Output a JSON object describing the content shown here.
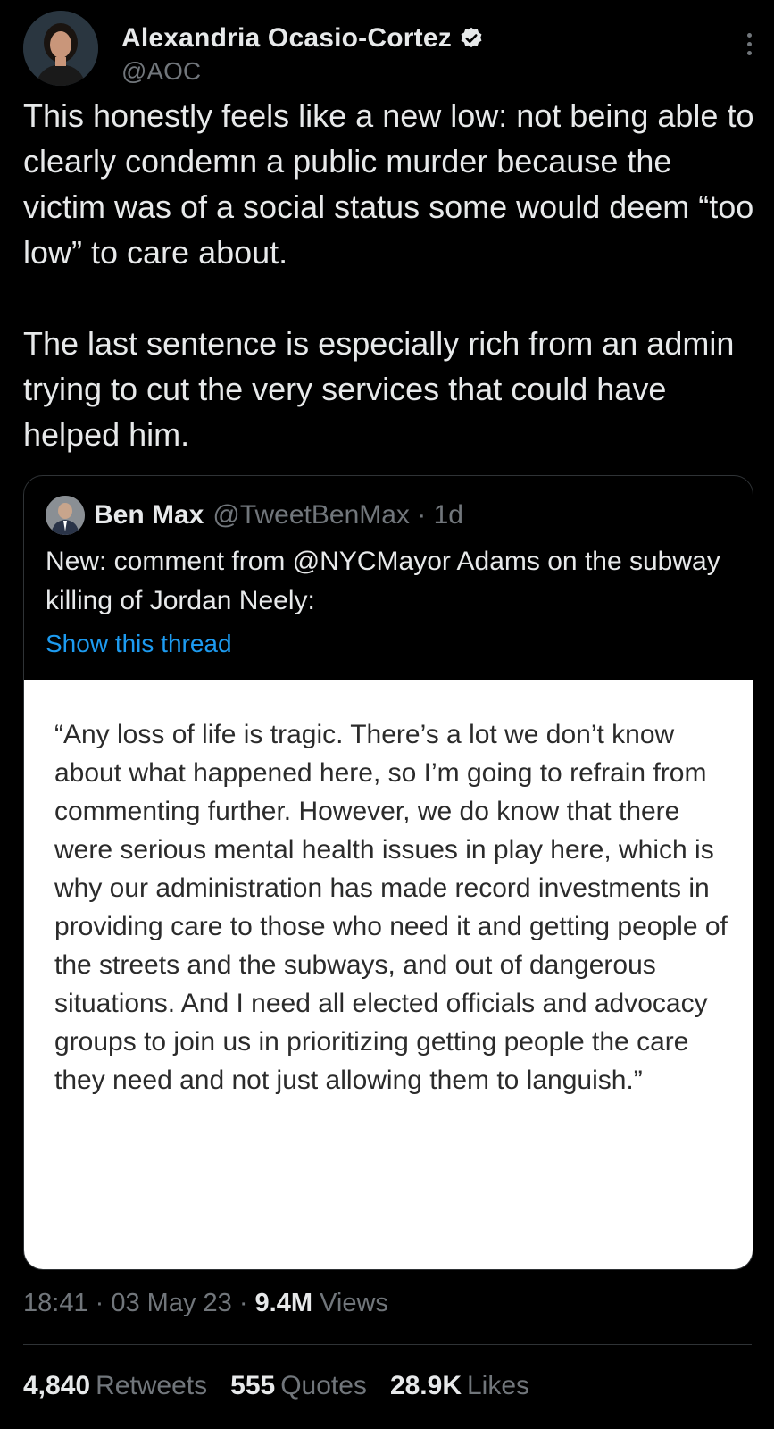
{
  "author": {
    "name": "Alexandria Ocasio-Cortez",
    "handle": "@AOC"
  },
  "tweet": {
    "paragraphs": [
      "This honestly feels like a new low: not being able to clearly condemn a public murder because the victim was of a social status some would deem “too low” to care about.",
      "The last sentence is especially rich from an admin trying to cut the very services that could have helped him."
    ]
  },
  "quoted_tweet": {
    "name": "Ben Max",
    "handle_time": "@TweetBenMax · 1d",
    "text": "New: comment from @NYCMayor Adams on the subway killing of Jordan Neely:",
    "show_thread": "Show this thread",
    "image_text": "“Any loss of life is tragic. There’s a lot we don’t know about what happened here, so I’m going to refrain from commenting further. However, we do know that there were serious mental health issues in play here, which is why our administration has made record investments in providing care to those who need it and getting people of the streets and the subways, and out of dangerous situations. And I need all elected officials and advocacy groups to join us in prioritizing getting people the care they need and not just allowing them to languish.”"
  },
  "meta": {
    "time_date": "18:41 · 03 May 23 · ",
    "views_count": "9.4M",
    "views_label": "Views"
  },
  "stats": {
    "retweets_count": "4,840",
    "retweets_label": "Retweets",
    "quotes_count": "555",
    "quotes_label": "Quotes",
    "likes_count": "28.9K",
    "likes_label": "Likes"
  },
  "colors": {
    "background": "#000000",
    "text": "#e7e9ea",
    "secondary": "#71767b",
    "link": "#1d9bf0",
    "verified": "#e7e9ea"
  },
  "icons": [
    "verified-badge-icon",
    "more-options-icon"
  ]
}
